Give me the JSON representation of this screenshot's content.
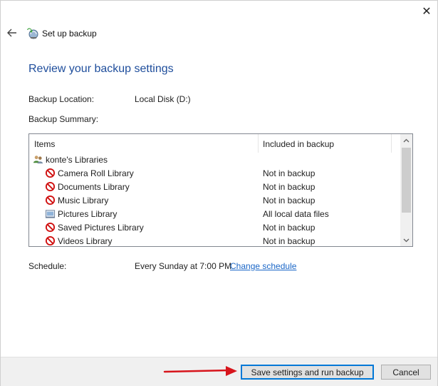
{
  "window": {
    "close_glyph": "✕"
  },
  "header": {
    "back_icon": "back-arrow-icon",
    "app_icon": "backup-icon",
    "title": "Set up backup"
  },
  "main": {
    "heading": "Review your backup settings",
    "backup_location_label": "Backup Location:",
    "backup_location_value": "Local Disk (D:)",
    "backup_summary_label": "Backup Summary:",
    "schedule_label": "Schedule:",
    "schedule_value": "Every Sunday at 7:00 PM",
    "change_schedule_link": "Change schedule"
  },
  "summary": {
    "columns": [
      "Items",
      "Included in backup"
    ],
    "group": {
      "label": "konte's Libraries",
      "icon": "users-icon"
    },
    "items": [
      {
        "name": "Camera Roll Library",
        "status": "Not in backup",
        "icon": "not-included-icon"
      },
      {
        "name": "Documents Library",
        "status": "Not in backup",
        "icon": "not-included-icon"
      },
      {
        "name": "Music Library",
        "status": "Not in backup",
        "icon": "not-included-icon"
      },
      {
        "name": "Pictures Library",
        "status": "All local data files",
        "icon": "library-icon"
      },
      {
        "name": "Saved Pictures Library",
        "status": "Not in backup",
        "icon": "not-included-icon"
      },
      {
        "name": "Videos Library",
        "status": "Not in backup",
        "icon": "not-included-icon"
      }
    ]
  },
  "footer": {
    "primary_button": "Save settings and run backup",
    "cancel_button": "Cancel"
  },
  "colors": {
    "heading": "#1f4e9c",
    "link": "#1a66c7",
    "annotation_arrow": "#d7141b",
    "not_included": "#d01010"
  }
}
